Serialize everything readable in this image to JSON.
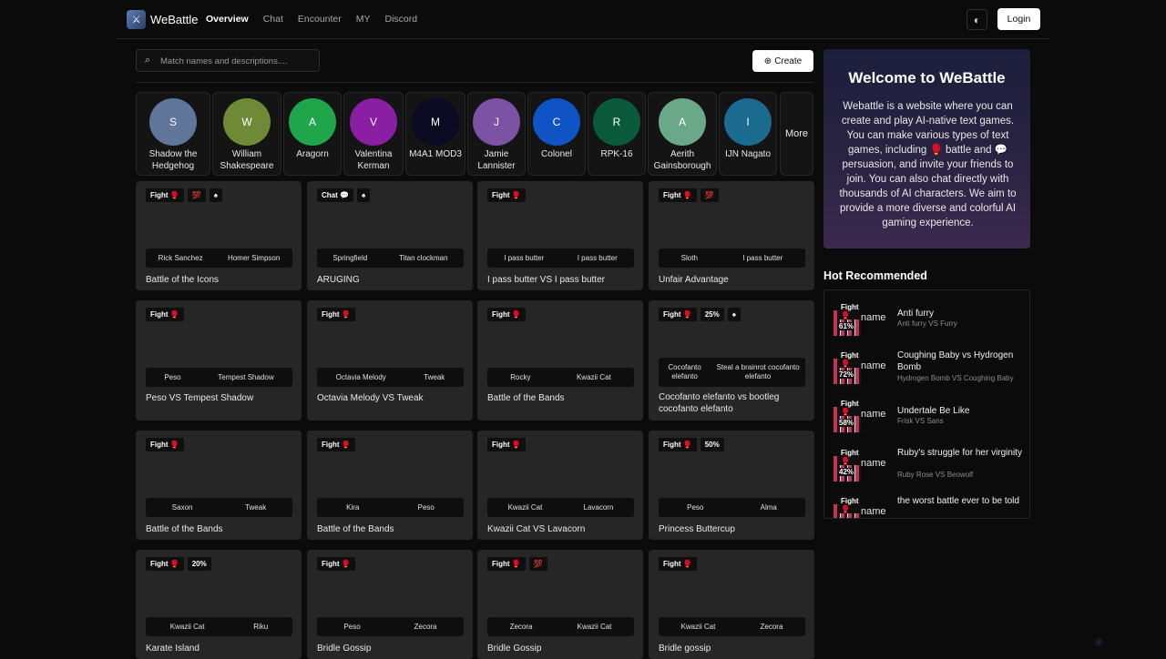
{
  "header": {
    "brand": "WeBattle",
    "nav": [
      "Overview",
      "Chat",
      "Encounter",
      "MY",
      "Discord"
    ],
    "login": "Login"
  },
  "search": {
    "placeholder": "Match names and descriptions...."
  },
  "create_label": "Create",
  "characters": [
    {
      "initial": "S",
      "name": "Shadow the Hedgehog",
      "color": "#5f7599"
    },
    {
      "initial": "W",
      "name": "William Shakespeare",
      "color": "#6f8a36"
    },
    {
      "initial": "A",
      "name": "Aragorn",
      "color": "#1fa64a"
    },
    {
      "initial": "V",
      "name": "Valentina Kerman",
      "color": "#8a1fa4"
    },
    {
      "initial": "M",
      "name": "M4A1 MOD3",
      "color": "#0a0a22"
    },
    {
      "initial": "J",
      "name": "Jamie Lannister",
      "color": "#7c52a5"
    },
    {
      "initial": "C",
      "name": "Colonel",
      "color": "#1053c5"
    },
    {
      "initial": "R",
      "name": "RPK-16",
      "color": "#0c5a3e"
    },
    {
      "initial": "A",
      "name": "Aerith Gainsborough",
      "color": "#6aa88a"
    },
    {
      "initial": "I",
      "name": "IJN Nagato",
      "color": "#1a6b8f"
    }
  ],
  "more_label": "More",
  "battles": [
    {
      "tags": [
        "Fight 🥊",
        "💯",
        "♠"
      ],
      "left": "Rick Sanchez",
      "right": "Homer Simpson",
      "title": "Battle of the Icons"
    },
    {
      "tags": [
        "Chat 💬",
        "♠"
      ],
      "left": "Springfield",
      "right": "Titan clockman",
      "title": "ARUGING"
    },
    {
      "tags": [
        "Fight 🥊"
      ],
      "left": "I pass butter",
      "right": "I pass butter",
      "title": "I pass butter VS I pass butter"
    },
    {
      "tags": [
        "Fight 🥊",
        "💯"
      ],
      "left": "Sloth",
      "right": "I pass butter",
      "title": "Unfair Advantage"
    },
    {
      "tags": [
        "Fight 🥊"
      ],
      "left": "Peso",
      "right": "Tempest Shadow",
      "title": "Peso VS Tempest Shadow"
    },
    {
      "tags": [
        "Fight 🥊"
      ],
      "left": "Octavia Melody",
      "right": "Tweak",
      "title": "Octavia Melody VS Tweak"
    },
    {
      "tags": [
        "Fight 🥊"
      ],
      "left": "Rocky",
      "right": "Kwazii Cat",
      "title": "Battle of the Bands"
    },
    {
      "tags": [
        "Fight 🥊",
        "25%",
        "♠"
      ],
      "left": "Cocofanto elefanto",
      "right": "Steal a brainrot cocofanto elefanto",
      "title": "Cocofanto elefanto vs bootleg cocofanto elefanto"
    },
    {
      "tags": [
        "Fight 🥊"
      ],
      "left": "Saxon",
      "right": "Tweak",
      "title": "Battle of the Bands"
    },
    {
      "tags": [
        "Fight 🥊"
      ],
      "left": "Kira",
      "right": "Peso",
      "title": "Battle of the Bands"
    },
    {
      "tags": [
        "Fight 🥊"
      ],
      "left": "Kwazii Cat",
      "right": "Lavacorn",
      "title": "Kwazii Cat VS Lavacorn"
    },
    {
      "tags": [
        "Fight 🥊",
        "50%"
      ],
      "left": "Peso",
      "right": "Alma",
      "title": "Princess Buttercup"
    },
    {
      "tags": [
        "Fight 🥊",
        "20%"
      ],
      "left": "Kwazii Cat",
      "right": "Riku",
      "title": "Karate Island"
    },
    {
      "tags": [
        "Fight 🥊"
      ],
      "left": "Peso",
      "right": "Zecora",
      "title": "Bridle Gossip"
    },
    {
      "tags": [
        "Fight 🥊",
        "💯"
      ],
      "left": "Zecora",
      "right": "Kwazii Cat",
      "title": "Bridle Gossip"
    },
    {
      "tags": [
        "Fight 🥊"
      ],
      "left": "Kwazii Cat",
      "right": "Zecora",
      "title": "Bridle gossip"
    }
  ],
  "welcome": {
    "title": "Welcome to WeBattle",
    "text": "Webattle is a website where you can create and play AI-native text games. You can make various types of text games, including 🥊 battle and 💬 persuasion, and invite your friends to join. You can also chat directly with thousands of AI characters. We aim to provide a more diverse and colorful AI gaming experience."
  },
  "hot": {
    "title": "Hot Recommended",
    "items": [
      {
        "tag": "Fight 🥊",
        "pct": "61%",
        "name_text": "name",
        "title": "Anti furry",
        "subtitle": "Anti furry VS Furry"
      },
      {
        "tag": "Fight 🥊",
        "pct": "72%",
        "name_text": "name",
        "title": "Coughing Baby vs Hydrogen Bomb",
        "subtitle": "Hydrogen Bomb VS Coughing Baby"
      },
      {
        "tag": "Fight 🥊",
        "pct": "58%",
        "name_text": "name",
        "title": "Undertale Be Like",
        "subtitle": "Frisk VS Sans"
      },
      {
        "tag": "Fight 🥊",
        "pct": "42%",
        "name_text": "name",
        "title": "Ruby's struggle for her virginity",
        "subtitle": "Ruby Rose VS Beowolf"
      },
      {
        "tag": "Fight 🥊",
        "pct": "",
        "name_text": "name",
        "title": "the worst battle ever to be told",
        "subtitle": ""
      }
    ]
  }
}
